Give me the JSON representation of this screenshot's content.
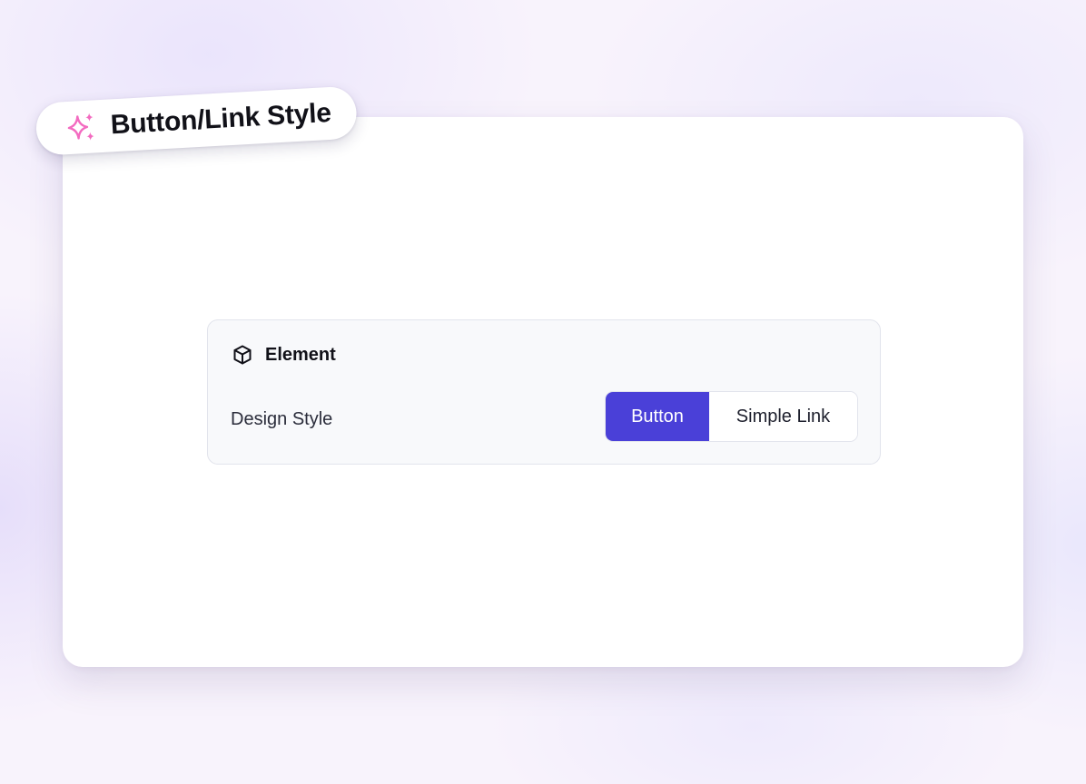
{
  "badge": {
    "title": "Button/Link Style",
    "icon": "sparkles-icon",
    "icon_color": "#f36bc0"
  },
  "panel": {
    "header": {
      "icon": "cube-icon",
      "title": "Element"
    },
    "setting": {
      "label": "Design Style",
      "options": [
        {
          "label": "Button",
          "selected": true
        },
        {
          "label": "Simple Link",
          "selected": false
        }
      ]
    }
  },
  "colors": {
    "accent": "#4a40d8",
    "card_bg": "#ffffff",
    "panel_bg": "#f8f9fb"
  }
}
